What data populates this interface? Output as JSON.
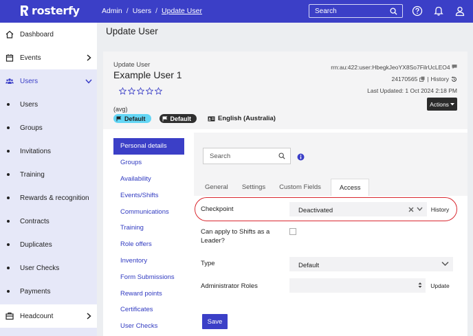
{
  "brand": {
    "name": "rosterfy",
    "accent": "#3b3fc7",
    "sidebar_bg": "#e6e8f8",
    "highlight": "#d9262e"
  },
  "breadcrumbs": [
    "Admin",
    "Users",
    "Update User"
  ],
  "topbar": {
    "search_placeholder": "Search",
    "icons": [
      "help-icon",
      "bell-icon",
      "user-icon"
    ]
  },
  "sidebar": {
    "dashboard": "Dashboard",
    "events": "Events",
    "users": "Users",
    "sub": [
      "Users",
      "Groups",
      "Invitations",
      "Training",
      "Rewards & recognition",
      "Contracts",
      "Duplicates",
      "User Checks",
      "Payments"
    ],
    "headcount": "Headcount"
  },
  "page": {
    "title": "Update User"
  },
  "user": {
    "label": "Update User",
    "name": "Example User 1",
    "rating_stars": 0,
    "rating_max": 5,
    "avg": "(avg)",
    "badge_blue": "Default",
    "badge_dark": "Default",
    "language": "English (Australia)",
    "rrn": "rrn:au:422:user:HbegkJeoYX8So7FilrUcLEO4",
    "id": "24170565",
    "history": "History",
    "last_updated": "Last Updated: 1 Oct 2024 2:18 PM",
    "actions": "Actions"
  },
  "menu": [
    "Personal details",
    "Groups",
    "Availability",
    "Events/Shifts",
    "Communications",
    "Training",
    "Role offers",
    "Inventory",
    "Form Submissions",
    "Reward points",
    "Certificates",
    "User Checks"
  ],
  "panel": {
    "search_placeholder": "Search",
    "tabs": [
      "General",
      "Settings",
      "Custom Fields",
      "Access"
    ],
    "checkpoint_label": "Checkpoint",
    "checkpoint_value": "Deactivated",
    "history_btn": "History",
    "leader_label": "Can apply to Shifts as a Leader?",
    "type_label": "Type",
    "type_value": "Default",
    "admin_roles_label": "Administrator Roles",
    "admin_roles_value": "",
    "update_btn": "Update",
    "save_btn": "Save"
  }
}
